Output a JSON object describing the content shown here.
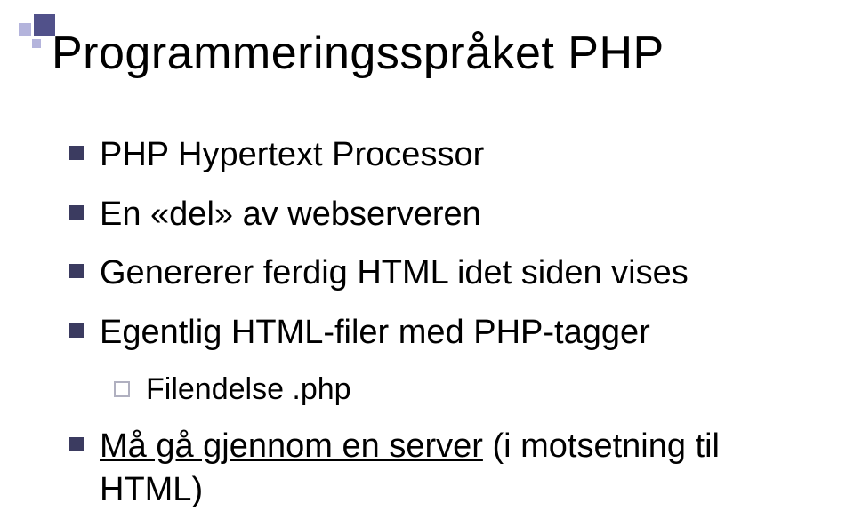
{
  "heading": "Programmeringsspråket PHP",
  "bullets": {
    "b1": "PHP Hypertext Processor",
    "b2": "En «del» av webserveren",
    "b3": "Genererer ferdig HTML idet siden vises",
    "b4": "Egentlig HTML-filer med PHP-tagger",
    "b4a": "Filendelse .php",
    "b5_underlined": "Må gå gjennom en server",
    "b5_rest": " (i motsetning til HTML)"
  }
}
